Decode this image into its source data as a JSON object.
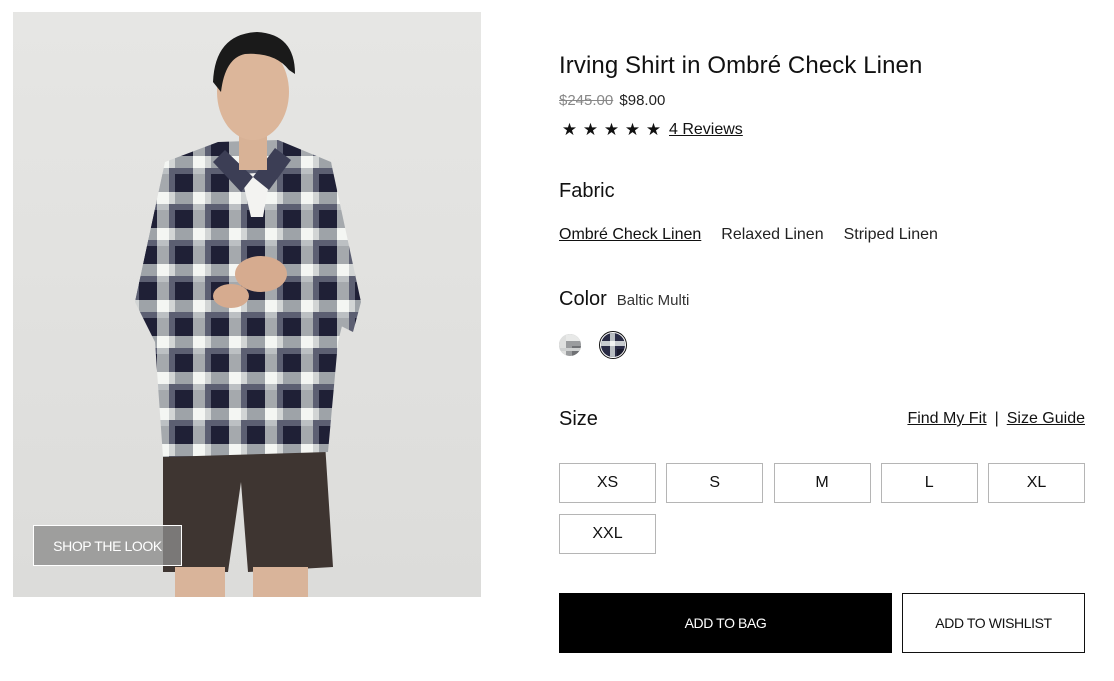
{
  "product": {
    "title": "Irving Shirt in Ombré Check Linen",
    "price_original": "$245.00",
    "price_sale": "$98.00",
    "rating": 5,
    "stars": [
      "★",
      "★",
      "★",
      "★",
      "★"
    ],
    "reviews_label": "4 Reviews"
  },
  "image": {
    "shop_the_look_label": "SHOP THE LOOK"
  },
  "fabric": {
    "label": "Fabric",
    "options": [
      "Ombré Check Linen",
      "Relaxed Linen",
      "Striped Linen"
    ],
    "selected": "Ombré Check Linen"
  },
  "color": {
    "label": "Color",
    "selected_name": "Baltic Multi",
    "swatches": [
      {
        "icon": "grey-check-swatch-icon",
        "selected": false
      },
      {
        "icon": "baltic-check-swatch-icon",
        "selected": true
      }
    ]
  },
  "size": {
    "label": "Size",
    "find_fit_label": "Find My Fit",
    "separator": "|",
    "guide_label": "Size Guide",
    "options": [
      "XS",
      "S",
      "M",
      "L",
      "XL",
      "XXL"
    ]
  },
  "actions": {
    "add_to_bag_label": "ADD TO BAG",
    "add_to_wishlist_label": "ADD TO WISHLIST"
  },
  "colors": {
    "image_background": "#e3e3e1",
    "plaid_dark": "#2c2c44",
    "plaid_light": "#e8ece8",
    "shorts": "#3e3531",
    "button_primary": "#000000",
    "size_border": "#b5b5b5"
  }
}
